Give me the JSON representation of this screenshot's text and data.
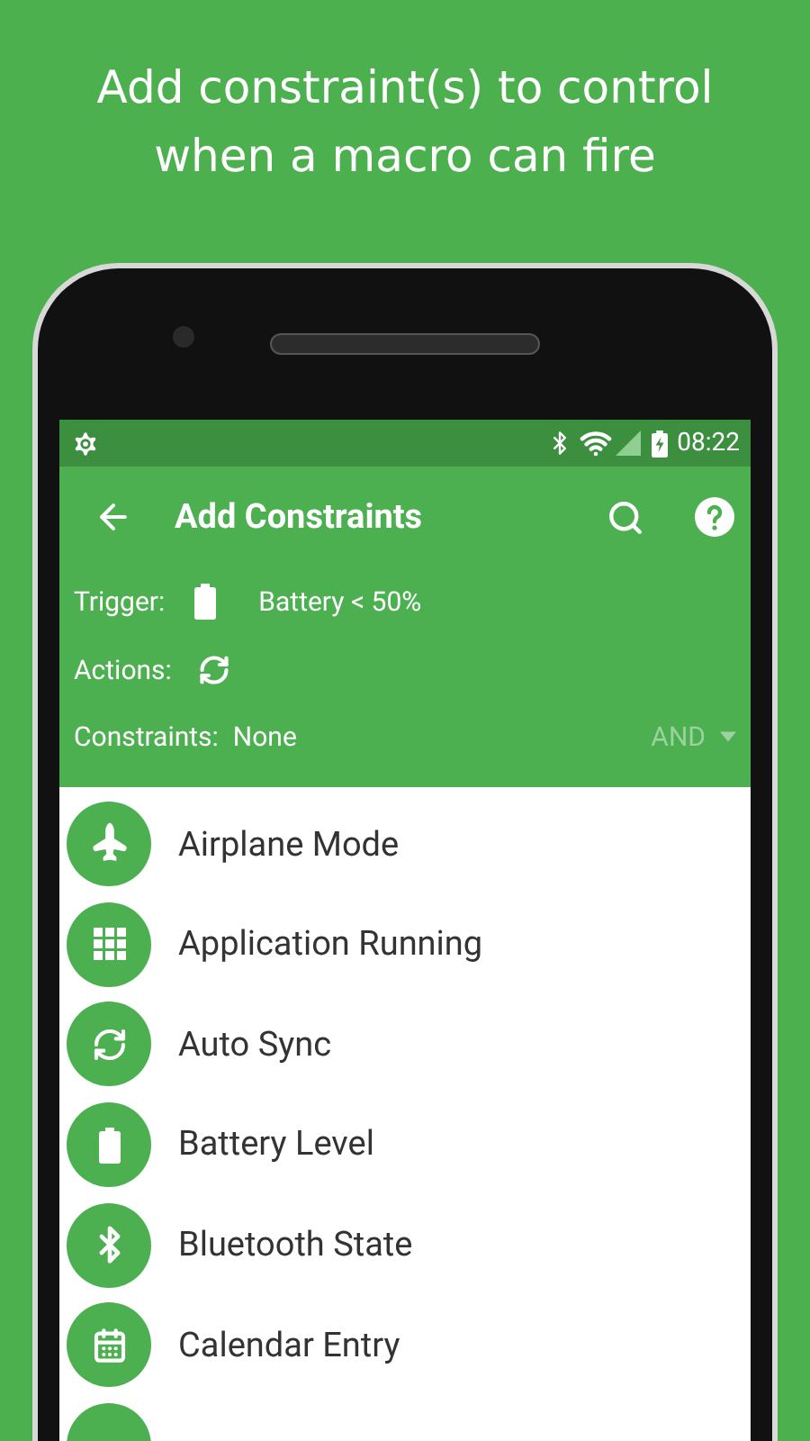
{
  "headline": [
    "Add constraint(s) to control",
    "when a macro can fire"
  ],
  "status_bar": {
    "time": "08:22"
  },
  "toolbar": {
    "title": "Add Constraints"
  },
  "summary": {
    "trigger_label": "Trigger:",
    "trigger_value": "Battery < 50%",
    "actions_label": "Actions:",
    "constraints_label": "Constraints:",
    "constraints_value": "None",
    "logic": "AND"
  },
  "constraints": [
    {
      "kind": "airplane",
      "label": "Airplane Mode"
    },
    {
      "kind": "apps",
      "label": "Application Running"
    },
    {
      "kind": "sync",
      "label": "Auto Sync"
    },
    {
      "kind": "battery",
      "label": "Battery Level"
    },
    {
      "kind": "bluetooth",
      "label": "Bluetooth State"
    },
    {
      "kind": "calendar",
      "label": "Calendar Entry"
    },
    {
      "kind": "partial"
    }
  ]
}
